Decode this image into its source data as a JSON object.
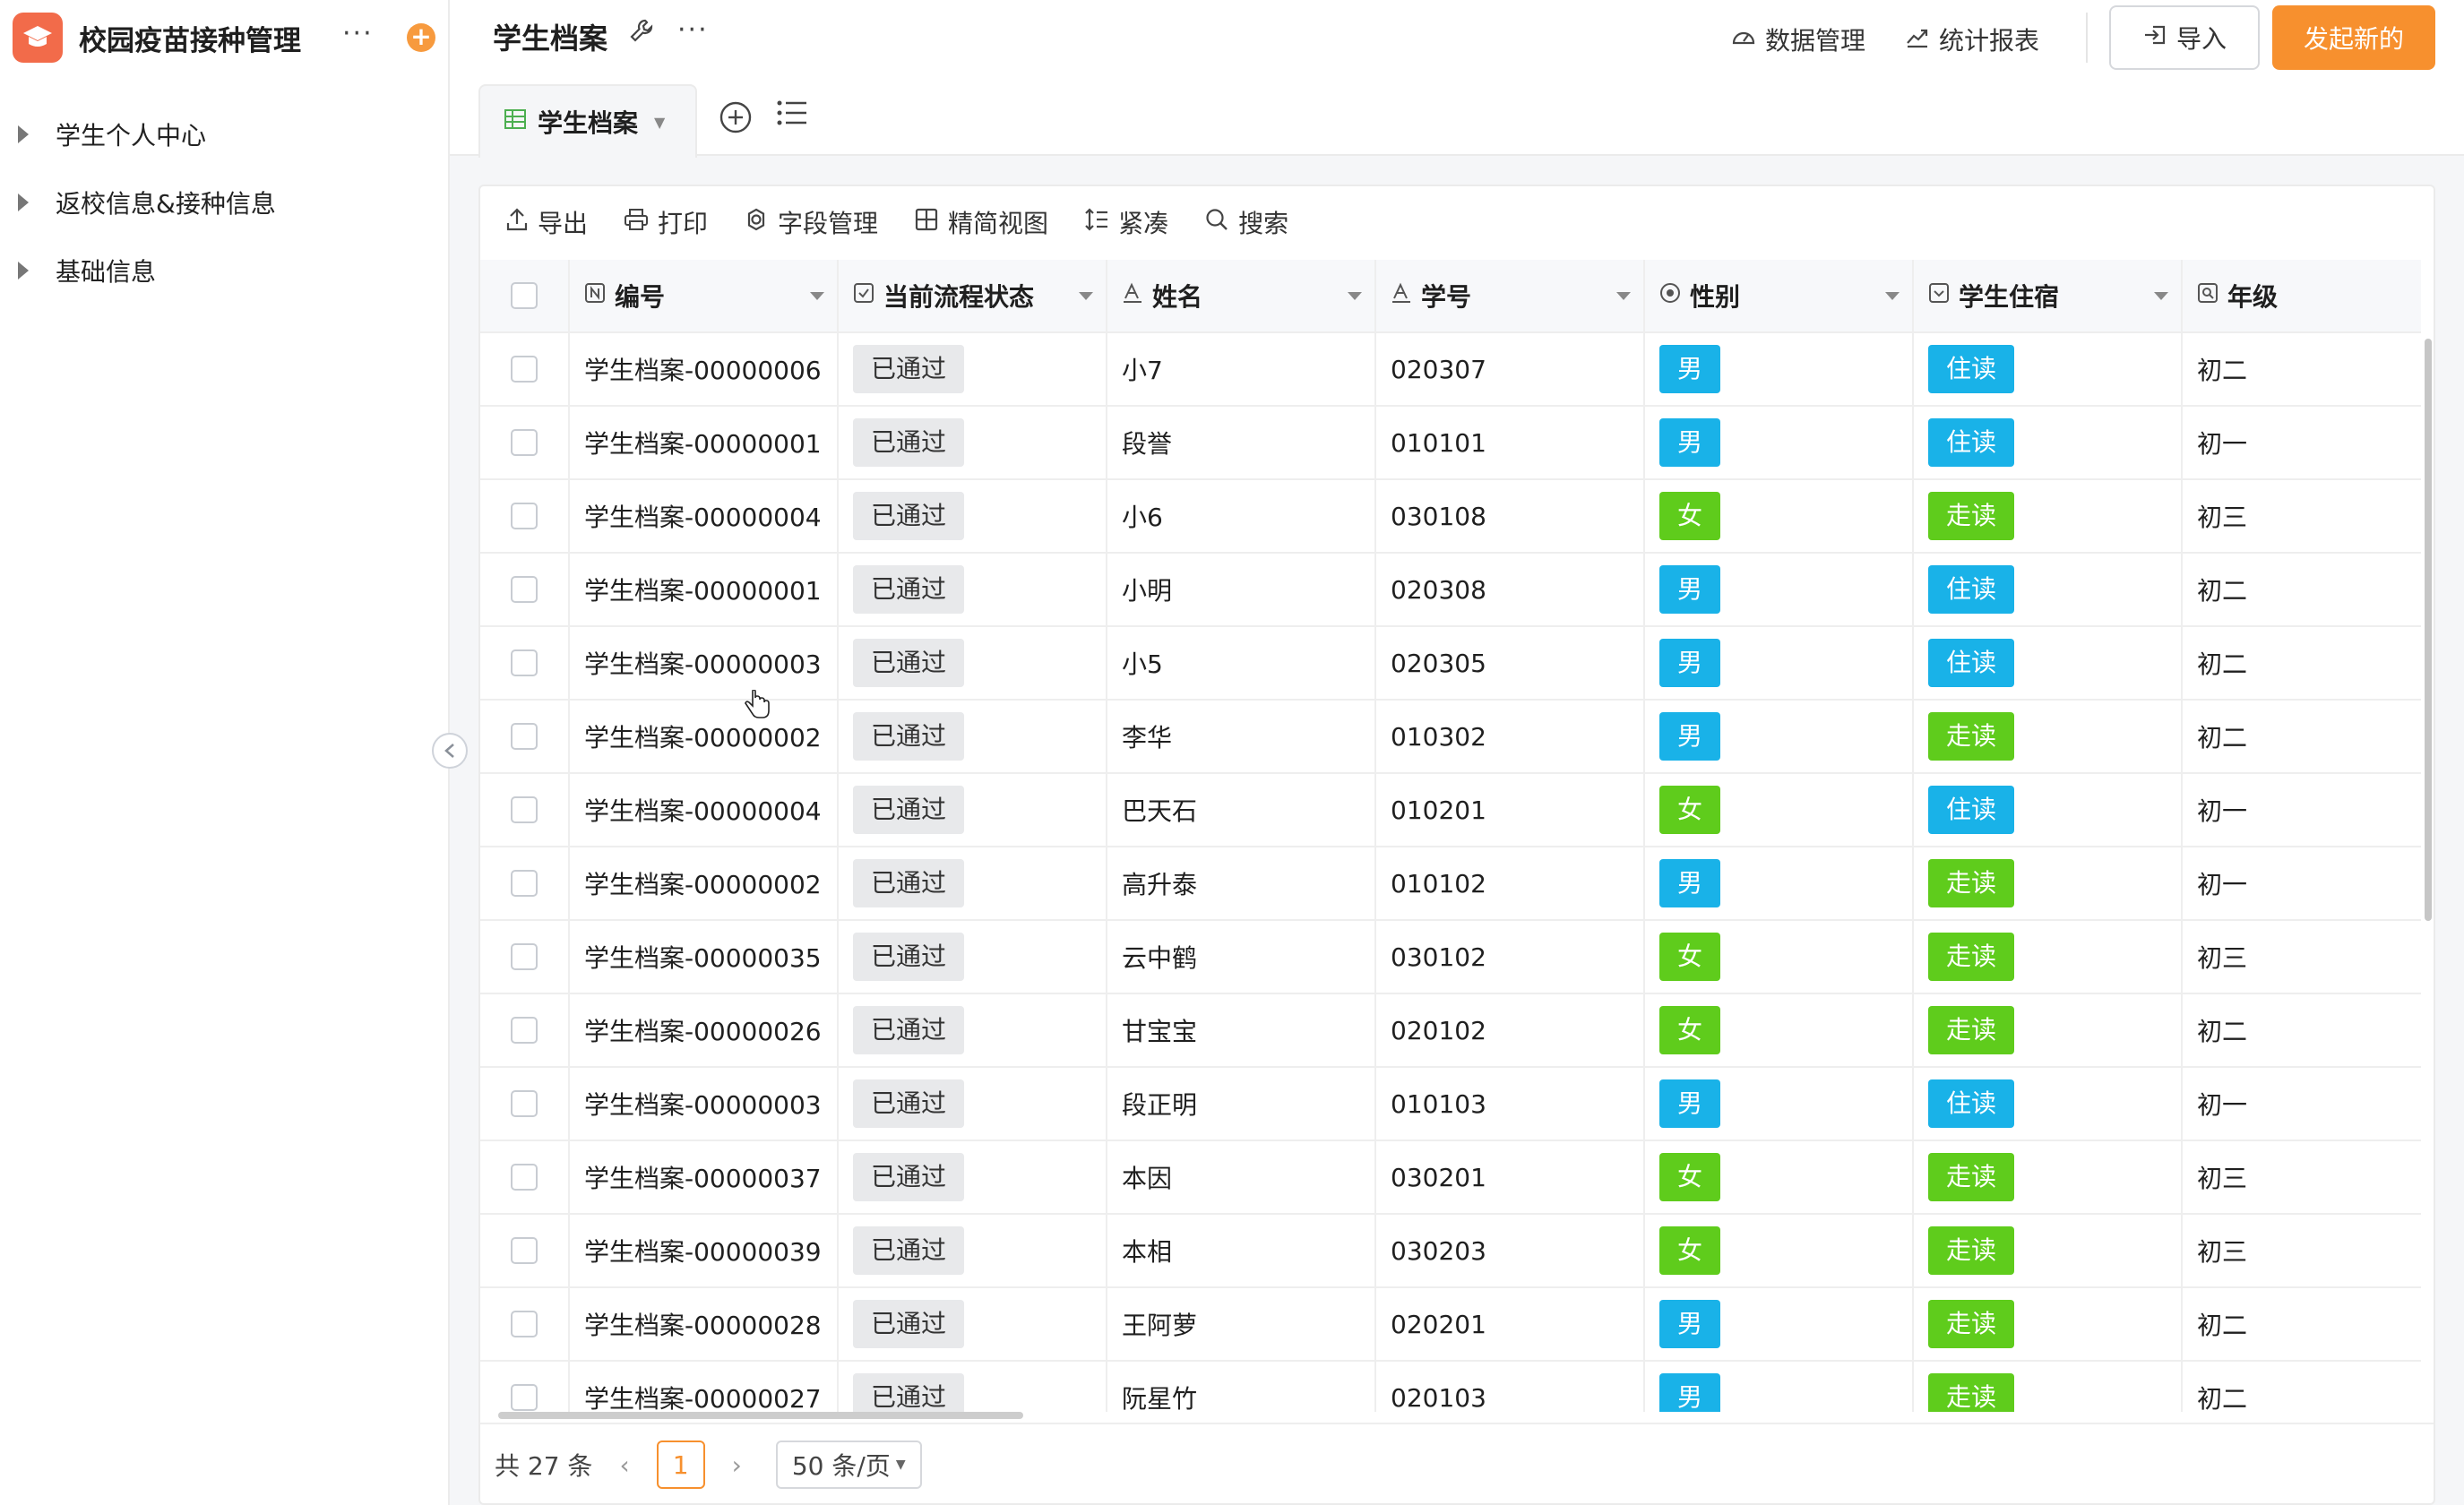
{
  "sidebar": {
    "app_title": "校园疫苗接种管理",
    "items": [
      {
        "label": "学生个人中心"
      },
      {
        "label": "返校信息&接种信息"
      },
      {
        "label": "基础信息"
      }
    ]
  },
  "header": {
    "page_title": "学生档案",
    "data_manage": "数据管理",
    "stats_report": "统计报表",
    "import_label": "导入",
    "start_label": "发起新的"
  },
  "view_tab": {
    "label": "学生档案"
  },
  "toolbar": {
    "export": "导出",
    "print": "打印",
    "fields": "字段管理",
    "compact_view": "精简视图",
    "dense": "紧凑",
    "search": "搜索"
  },
  "columns": [
    "编号",
    "当前流程状态",
    "姓名",
    "学号",
    "性别",
    "学生住宿",
    "年级"
  ],
  "rows": [
    {
      "id": "学生档案-00000006",
      "status": "已通过",
      "name": "小7",
      "sno": "020307",
      "gender": "男",
      "dorm": "住读",
      "grade": "初二"
    },
    {
      "id": "学生档案-00000001",
      "status": "已通过",
      "name": "段誉",
      "sno": "010101",
      "gender": "男",
      "dorm": "住读",
      "grade": "初一"
    },
    {
      "id": "学生档案-00000004",
      "status": "已通过",
      "name": "小6",
      "sno": "030108",
      "gender": "女",
      "dorm": "走读",
      "grade": "初三"
    },
    {
      "id": "学生档案-00000001",
      "status": "已通过",
      "name": "小明",
      "sno": "020308",
      "gender": "男",
      "dorm": "住读",
      "grade": "初二"
    },
    {
      "id": "学生档案-00000003",
      "status": "已通过",
      "name": "小5",
      "sno": "020305",
      "gender": "男",
      "dorm": "住读",
      "grade": "初二"
    },
    {
      "id": "学生档案-00000002",
      "status": "已通过",
      "name": "李华",
      "sno": "010302",
      "gender": "男",
      "dorm": "走读",
      "grade": "初二"
    },
    {
      "id": "学生档案-00000004",
      "status": "已通过",
      "name": "巴天石",
      "sno": "010201",
      "gender": "女",
      "dorm": "住读",
      "grade": "初一"
    },
    {
      "id": "学生档案-00000002",
      "status": "已通过",
      "name": "高升泰",
      "sno": "010102",
      "gender": "男",
      "dorm": "走读",
      "grade": "初一"
    },
    {
      "id": "学生档案-00000035",
      "status": "已通过",
      "name": "云中鹤",
      "sno": "030102",
      "gender": "女",
      "dorm": "走读",
      "grade": "初三"
    },
    {
      "id": "学生档案-00000026",
      "status": "已通过",
      "name": "甘宝宝",
      "sno": "020102",
      "gender": "女",
      "dorm": "走读",
      "grade": "初二"
    },
    {
      "id": "学生档案-00000003",
      "status": "已通过",
      "name": "段正明",
      "sno": "010103",
      "gender": "男",
      "dorm": "住读",
      "grade": "初一"
    },
    {
      "id": "学生档案-00000037",
      "status": "已通过",
      "name": "本因",
      "sno": "030201",
      "gender": "女",
      "dorm": "走读",
      "grade": "初三"
    },
    {
      "id": "学生档案-00000039",
      "status": "已通过",
      "name": "本相",
      "sno": "030203",
      "gender": "女",
      "dorm": "走读",
      "grade": "初三"
    },
    {
      "id": "学生档案-00000028",
      "status": "已通过",
      "name": "王阿萝",
      "sno": "020201",
      "gender": "男",
      "dorm": "走读",
      "grade": "初二"
    },
    {
      "id": "学生档案-00000027",
      "status": "已通过",
      "name": "阮星竹",
      "sno": "020103",
      "gender": "男",
      "dorm": "走读",
      "grade": "初二"
    }
  ],
  "pagination": {
    "total": "共 27 条",
    "current": "1",
    "page_size": "50 条/页"
  },
  "colors": {
    "accent": "#f7902e",
    "tag_blue": "#19b2e8",
    "tag_green": "#5fcc1c"
  }
}
